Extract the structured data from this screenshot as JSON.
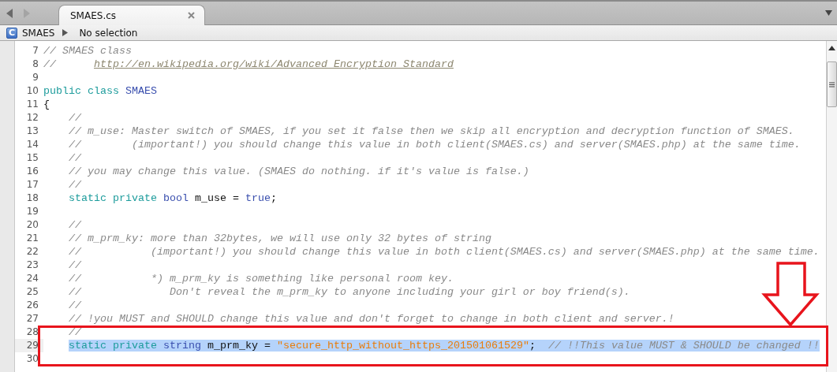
{
  "nav": [
    {
      "kind": "back",
      "disabled": false
    },
    {
      "kind": "forward",
      "disabled": true
    }
  ],
  "tabs": [
    {
      "label": "SMAES.cs",
      "selected": true
    }
  ],
  "breadcrumb": {
    "icon_letter": "C",
    "items": [
      {
        "label": "SMAES"
      },
      {
        "label": "No selection"
      }
    ]
  },
  "lines": [
    {
      "number": "7",
      "selected": false,
      "tokens": [
        {
          "kind": "comment",
          "text": "// SMAES class"
        }
      ]
    },
    {
      "number": "8",
      "selected": false,
      "tokens": [
        {
          "kind": "comment",
          "text": "//      "
        },
        {
          "kind": "link",
          "text": "http://en.wikipedia.org/wiki/Advanced_Encryption_Standard"
        }
      ]
    },
    {
      "number": "9",
      "selected": false
    },
    {
      "number": "10",
      "selected": false,
      "tokens": [
        {
          "kind": "keyword",
          "text": "public class "
        },
        {
          "kind": "type",
          "text": "SMAES"
        }
      ]
    },
    {
      "number": "11",
      "selected": false,
      "tokens": [
        {
          "kind": "plain",
          "text": "{"
        }
      ]
    },
    {
      "number": "12",
      "selected": false,
      "tokens": [
        {
          "kind": "comment",
          "text": "    //"
        }
      ]
    },
    {
      "number": "13",
      "selected": false,
      "tokens": [
        {
          "kind": "comment",
          "text": "    // m_use: Master switch of SMAES, if you set it false then we skip all encryption and decryption function of SMAES."
        }
      ]
    },
    {
      "number": "14",
      "selected": false,
      "tokens": [
        {
          "kind": "comment",
          "text": "    //        (important!) you should change this value in both client(SMAES.cs) and server(SMAES.php) at the same time."
        }
      ]
    },
    {
      "number": "15",
      "selected": false,
      "tokens": [
        {
          "kind": "comment",
          "text": "    //"
        }
      ]
    },
    {
      "number": "16",
      "selected": false,
      "tokens": [
        {
          "kind": "comment",
          "text": "    // you may change this value. (SMAES do nothing. if it's value is false.)"
        }
      ]
    },
    {
      "number": "17",
      "selected": false,
      "tokens": [
        {
          "kind": "comment",
          "text": "    //"
        }
      ]
    },
    {
      "number": "18",
      "selected": false,
      "tokens": [
        {
          "kind": "keyword",
          "text": "    static private "
        },
        {
          "kind": "type",
          "text": "bool"
        },
        {
          "kind": "plain",
          "text": " m_use = "
        },
        {
          "kind": "type",
          "text": "true"
        },
        {
          "kind": "plain",
          "text": ";"
        }
      ]
    },
    {
      "number": "19",
      "selected": false
    },
    {
      "number": "20",
      "selected": false,
      "tokens": [
        {
          "kind": "comment",
          "text": "    //"
        }
      ]
    },
    {
      "number": "21",
      "selected": false,
      "tokens": [
        {
          "kind": "comment",
          "text": "    // m_prm_ky: more than 32bytes, we will use only 32 bytes of string"
        }
      ]
    },
    {
      "number": "22",
      "selected": false,
      "tokens": [
        {
          "kind": "comment",
          "text": "    //           (important!) you should change this value in both client(SMAES.cs) and server(SMAES.php) at the same time."
        }
      ]
    },
    {
      "number": "23",
      "selected": false,
      "tokens": [
        {
          "kind": "comment",
          "text": "    //"
        }
      ]
    },
    {
      "number": "24",
      "selected": false,
      "tokens": [
        {
          "kind": "comment",
          "text": "    //           *) m_prm_ky is something like personal room key."
        }
      ]
    },
    {
      "number": "25",
      "selected": false,
      "tokens": [
        {
          "kind": "comment",
          "text": "    //              Don't reveal the m_prm_ky to anyone including your girl or boy friend(s)."
        }
      ]
    },
    {
      "number": "26",
      "selected": false,
      "tokens": [
        {
          "kind": "comment",
          "text": "    //"
        }
      ]
    },
    {
      "number": "27",
      "selected": false,
      "tokens": [
        {
          "kind": "comment",
          "text": "    // !you MUST and SHOULD change this value and don't forget to change in both client and server.!"
        }
      ]
    },
    {
      "number": "28",
      "selected": false,
      "tokens": [
        {
          "kind": "comment",
          "text": "    //"
        }
      ]
    },
    {
      "number": "29",
      "selected": true,
      "tokens": [
        {
          "kind": "keyword",
          "text": "    static private "
        },
        {
          "kind": "type",
          "text": "string"
        },
        {
          "kind": "plain",
          "text": " m_prm_ky = "
        },
        {
          "kind": "string",
          "text": "\"secure_http_without_https_201501061529\""
        },
        {
          "kind": "plain",
          "text": ";  "
        },
        {
          "kind": "comment",
          "text": "// !!This value MUST & SHOULD be changed !!"
        }
      ]
    },
    {
      "number": "30",
      "selected": false
    }
  ]
}
